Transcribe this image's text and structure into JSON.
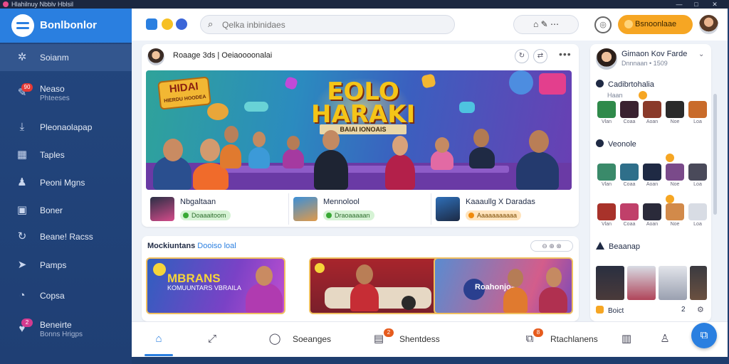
{
  "window": {
    "title": "Hlahilnuy Nbblv Hblsil",
    "minimize": "—",
    "maximize": "□",
    "close": "✕"
  },
  "brand": {
    "name": "Bonlbonlor"
  },
  "sidebar": {
    "items": [
      {
        "label": "Soianm",
        "icon": "globe-icon",
        "glyph": "✲"
      },
      {
        "label": "Neaso",
        "sub": "Phteeses",
        "badge": "90",
        "icon": "chat-icon",
        "glyph": "✎"
      },
      {
        "label": "Pleonaolapap",
        "icon": "download-icon",
        "glyph": "⤓"
      },
      {
        "label": "Taples",
        "icon": "grid-icon",
        "glyph": "▦"
      },
      {
        "label": "Peoni Mgns",
        "icon": "group-icon",
        "glyph": "♟"
      },
      {
        "label": "Boner",
        "icon": "box-icon",
        "glyph": "▣"
      },
      {
        "label": "Beane! Racss",
        "icon": "sync-icon",
        "glyph": "↻"
      },
      {
        "label": "Pamps",
        "icon": "pin-icon",
        "glyph": "➤"
      },
      {
        "label": "Copsa",
        "icon": "bubble-icon",
        "glyph": "◔"
      },
      {
        "label": "Beneirte",
        "sub": "Bonns Hrigps",
        "badge": "2",
        "icon": "heart-icon",
        "glyph": "♥"
      }
    ]
  },
  "topbar": {
    "icons": [
      "app-icon-1",
      "app-icon-2",
      "app-icon-3"
    ],
    "search_placeholder": "Qelka inbinidaes",
    "pill_label": "⌂ ✎ ⋯",
    "cta_label": "Bsnoonlaae",
    "colors": {
      "cta": "#f6a623",
      "accent": "#2a7fe0"
    }
  },
  "feature": {
    "title": "Roaage 3ds | Oeiaoooonalai",
    "banner_sign": "HIDAI",
    "banner_sign_small": "HIERDU HOODEA",
    "banner_title_line1": "EOLO",
    "banner_title_line2": "HARAKI",
    "banner_subtitle": "BAIAI IONOAIS",
    "presenters": [
      {
        "name": "Nbgaltaan",
        "tag": "Doaaaitoom",
        "tag_color": "green"
      },
      {
        "name": "Mennolool",
        "tag": "Draoaaaaan",
        "tag_color": "green"
      },
      {
        "name": "Kaaaullg X Daradas",
        "tag": "Aaaaaaaaaaa",
        "tag_color": "orange"
      }
    ]
  },
  "recommendations": {
    "title": "Mockiuntans",
    "highlight": "Dooiso loal",
    "control": "⊖ ⊕ ⊗",
    "cards": [
      {
        "title": "MBRANS",
        "subtitle": "KOMUUNTARS VBRAILA"
      },
      {
        "title": "",
        "subtitle": ""
      },
      {
        "title": "Roahonjoa",
        "subtitle": ""
      }
    ]
  },
  "rightpanel": {
    "user_name": "Gimaon Kov Farde",
    "user_sub": "Dnnnaan • 1509",
    "section1_title": "Cadibrtohalia",
    "section1_sub": "Haan",
    "section2_title": "Veonole",
    "section3_title": "Beaanap",
    "footer_label": "Boict",
    "footer_count": "2",
    "face_labels": [
      "Vlan",
      "Coaa",
      "Aoan",
      "Noe",
      "Loa"
    ]
  },
  "bottomnav": {
    "items": [
      {
        "label": "",
        "icon": "home-icon",
        "glyph": "⌂"
      },
      {
        "label": "",
        "icon": "trend-icon",
        "glyph": "⤢"
      },
      {
        "label": "Soeanges",
        "icon": "chat-bubble-icon",
        "glyph": "◯"
      },
      {
        "label": "Shentdess",
        "icon": "calendar-icon",
        "glyph": "▤",
        "badge": "2"
      },
      {
        "label": "Rtachlanens",
        "icon": "cart-icon",
        "glyph": "⧉",
        "badge": "8"
      },
      {
        "label": "",
        "icon": "badge-icon",
        "glyph": "▥"
      },
      {
        "label": "",
        "icon": "profile-icon",
        "glyph": "⌂"
      }
    ],
    "fab_glyph": "⧉"
  }
}
